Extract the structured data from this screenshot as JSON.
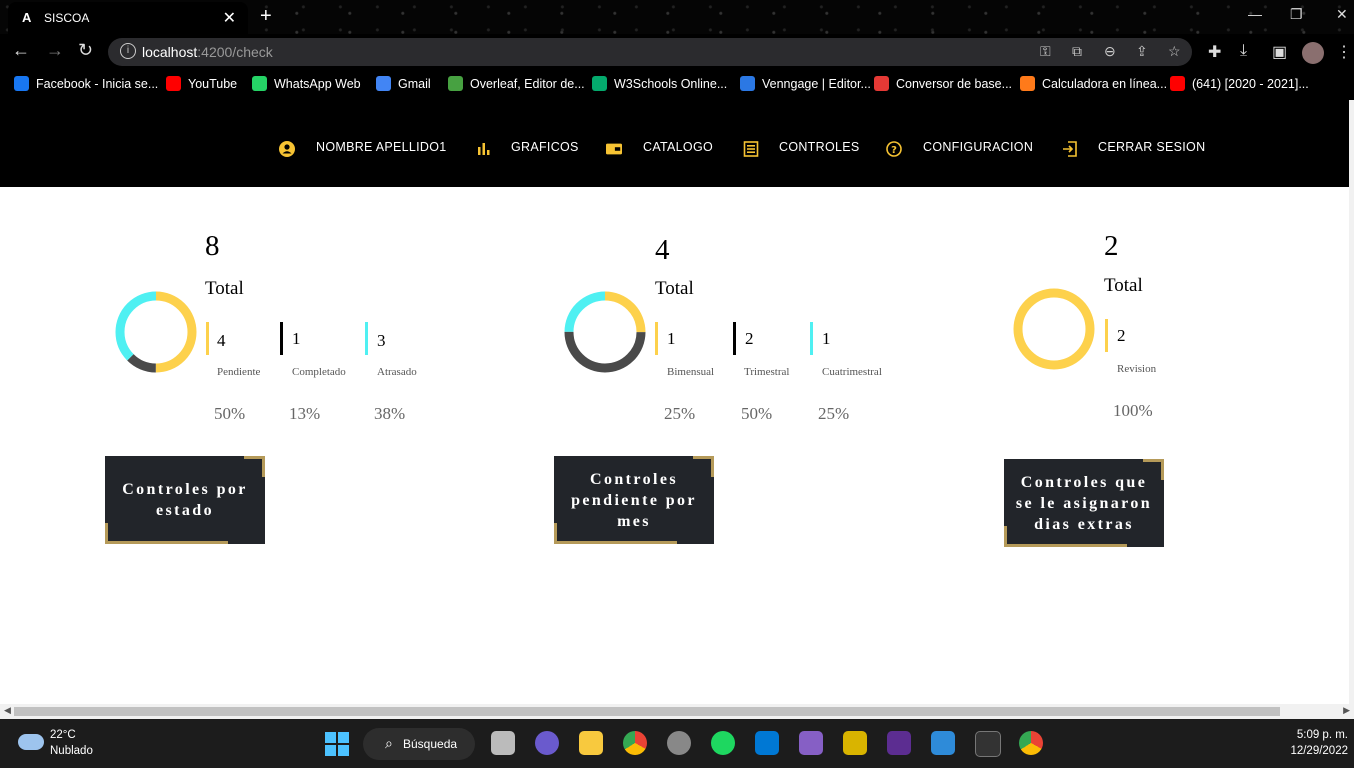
{
  "browser": {
    "tab_title": "SISCOA",
    "tab_favicon": "A",
    "url_host": "localhost",
    "url_path": ":4200/check",
    "bookmarks": [
      {
        "label": "Facebook - Inicia se...",
        "color": "#1877f2"
      },
      {
        "label": "YouTube",
        "color": "#ff0000"
      },
      {
        "label": "WhatsApp Web",
        "color": "#25d366"
      },
      {
        "label": "Gmail",
        "color": "#4285f4"
      },
      {
        "label": "Overleaf, Editor de...",
        "color": "#47a141"
      },
      {
        "label": "W3Schools Online...",
        "color": "#04aa6d"
      },
      {
        "label": "Venngage | Editor...",
        "color": "#2b78e4"
      },
      {
        "label": "Conversor de base...",
        "color": "#e53935"
      },
      {
        "label": "Calculadora en línea...",
        "color": "#ff7a1a"
      },
      {
        "label": "(641) [2020 - 2021]...",
        "color": "#ff0000"
      }
    ]
  },
  "nav": {
    "user": "NOMBRE APELLIDO1",
    "graficos": "GRAFICOS",
    "catalogo": "CATALOGO",
    "controles": "CONTROLES",
    "configuracion": "CONFIGURACION",
    "cerrar": "CERRAR SESION",
    "accent": "#f6c333"
  },
  "cards": [
    {
      "total_value": "8",
      "total_label": "Total",
      "items": [
        {
          "count": "4",
          "label": "Pendiente",
          "percent": "50%",
          "color": "#fdd14c"
        },
        {
          "count": "1",
          "label": "Completado",
          "percent": "13%",
          "color": "#4a4a4a"
        },
        {
          "count": "3",
          "label": "Atrasado",
          "percent": "38%",
          "color": "#4ff0f2"
        }
      ],
      "button": "Controles por estado"
    },
    {
      "total_value": "4",
      "total_label": "Total",
      "items": [
        {
          "count": "1",
          "label": "Bimensual",
          "percent": "25%",
          "color": "#fdd14c"
        },
        {
          "count": "2",
          "label": "Trimestral",
          "percent": "50%",
          "color": "#4a4a4a"
        },
        {
          "count": "1",
          "label": "Cuatrimestral",
          "percent": "25%",
          "color": "#4ff0f2"
        }
      ],
      "button": "Controles pendiente por mes"
    },
    {
      "total_value": "2",
      "total_label": "Total",
      "items": [
        {
          "count": "2",
          "label": "Revision",
          "percent": "100%",
          "color": "#fdd14c"
        }
      ],
      "button": "Controles que se le asignaron dias extras"
    }
  ],
  "donuts": [
    [
      {
        "fraction": 0.5,
        "color": "#fdd14c"
      },
      {
        "fraction": 0.125,
        "color": "#4a4a4a"
      },
      {
        "fraction": 0.375,
        "color": "#4ff0f2"
      }
    ],
    [
      {
        "fraction": 0.25,
        "color": "#fdd14c"
      },
      {
        "fraction": 0.5,
        "color": "#4a4a4a"
      },
      {
        "fraction": 0.25,
        "color": "#4ff0f2"
      }
    ],
    [
      {
        "fraction": 1.0,
        "color": "#fdd14c"
      }
    ]
  ],
  "taskbar": {
    "temp": "22°C",
    "weather": "Nublado",
    "search": "Búsqueda",
    "time": "5:09 p. m.",
    "date": "12/29/2022"
  }
}
